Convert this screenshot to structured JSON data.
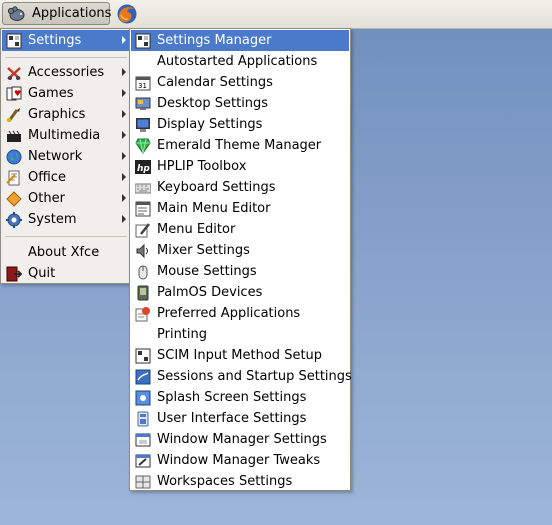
{
  "panel": {
    "app_button_label": "Applications"
  },
  "main_menu": {
    "settings": "Settings",
    "items": [
      {
        "label": "Accessories",
        "icon": "accessories-icon"
      },
      {
        "label": "Games",
        "icon": "games-icon"
      },
      {
        "label": "Graphics",
        "icon": "graphics-icon"
      },
      {
        "label": "Multimedia",
        "icon": "multimedia-icon"
      },
      {
        "label": "Network",
        "icon": "network-icon"
      },
      {
        "label": "Office",
        "icon": "office-icon"
      },
      {
        "label": "Other",
        "icon": "other-icon"
      },
      {
        "label": "System",
        "icon": "system-icon"
      }
    ],
    "about": "About Xfce",
    "quit": "Quit"
  },
  "settings_menu": {
    "items": [
      {
        "label": "Settings Manager",
        "icon": "settings-manager-icon"
      },
      {
        "label": "Autostarted Applications",
        "icon": ""
      },
      {
        "label": "Calendar Settings",
        "icon": "calendar-icon"
      },
      {
        "label": "Desktop Settings",
        "icon": "desktop-icon"
      },
      {
        "label": "Display Settings",
        "icon": "display-icon"
      },
      {
        "label": "Emerald Theme Manager",
        "icon": "emerald-icon"
      },
      {
        "label": "HPLIP Toolbox",
        "icon": "hp-icon"
      },
      {
        "label": "Keyboard Settings",
        "icon": "keyboard-icon"
      },
      {
        "label": "Main Menu Editor",
        "icon": "menu-editor-icon"
      },
      {
        "label": "Menu Editor",
        "icon": "pencil-icon"
      },
      {
        "label": "Mixer Settings",
        "icon": "mixer-icon"
      },
      {
        "label": "Mouse Settings",
        "icon": "mouse-icon"
      },
      {
        "label": "PalmOS Devices",
        "icon": "palm-icon"
      },
      {
        "label": "Preferred Applications",
        "icon": "preferred-apps-icon"
      },
      {
        "label": "Printing",
        "icon": ""
      },
      {
        "label": "SCIM Input Method Setup",
        "icon": "scim-icon"
      },
      {
        "label": "Sessions and Startup Settings",
        "icon": "sessions-icon"
      },
      {
        "label": "Splash Screen Settings",
        "icon": "splash-icon"
      },
      {
        "label": "User Interface Settings",
        "icon": "ui-icon"
      },
      {
        "label": "Window Manager Settings",
        "icon": "wm-icon"
      },
      {
        "label": "Window Manager Tweaks",
        "icon": "wm-tweaks-icon"
      },
      {
        "label": "Workspaces Settings",
        "icon": "workspaces-icon"
      }
    ]
  },
  "colors": {
    "highlight": "#4a7ac9",
    "desktop": "#7a97c4"
  }
}
